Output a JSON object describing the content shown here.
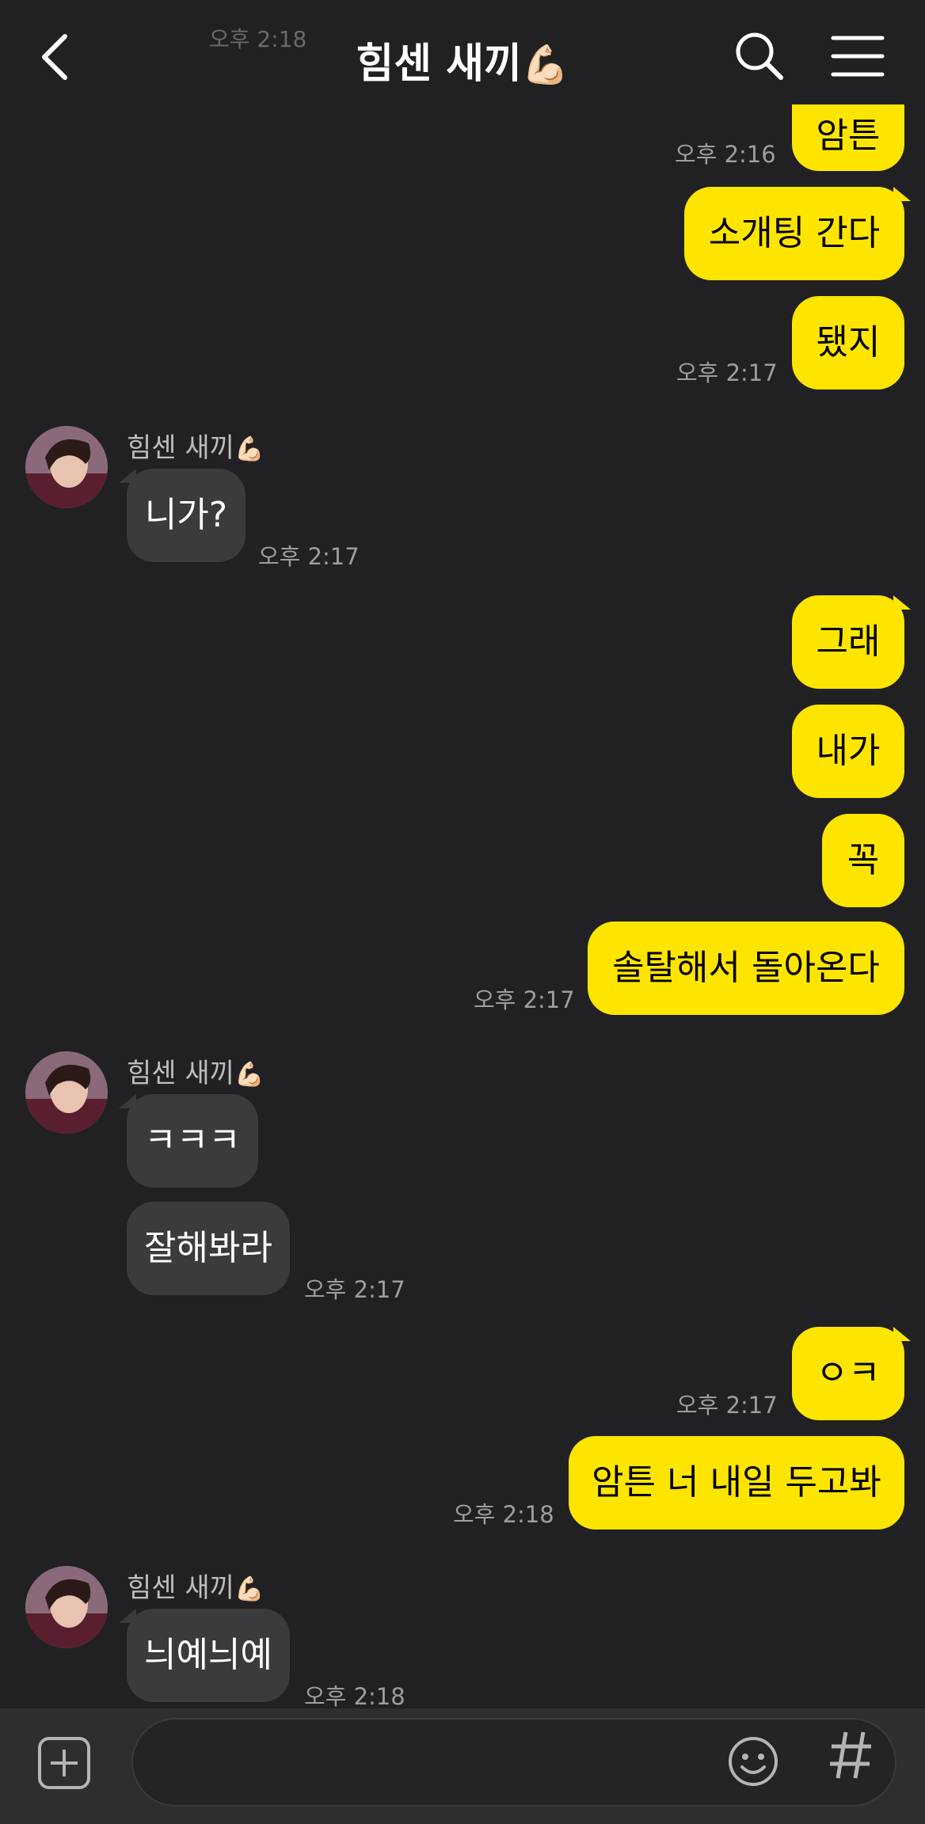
{
  "header": {
    "title": "힘센 새끼",
    "title_emoji": "💪🏻",
    "ghost_time": "오후 2:18"
  },
  "sender": {
    "name": "힘센 새끼",
    "emoji": "💪🏻"
  },
  "messages": [
    {
      "from": "me",
      "text": "암튼"
    },
    {
      "from": "me",
      "text": "소개팅 간다"
    },
    {
      "from": "me",
      "text": "됐지"
    },
    {
      "from": "them",
      "text": "니가?"
    },
    {
      "from": "me",
      "text": "그래"
    },
    {
      "from": "me",
      "text": "내가"
    },
    {
      "from": "me",
      "text": "꼭"
    },
    {
      "from": "me",
      "text": "솔탈해서 돌아온다"
    },
    {
      "from": "them",
      "text": "ㅋㅋㅋ"
    },
    {
      "from": "them",
      "text": "잘해봐라"
    },
    {
      "from": "me",
      "text": "ㅇㅋ"
    },
    {
      "from": "me",
      "text": "암튼 너 내일 두고봐"
    },
    {
      "from": "them",
      "text": "늬예늬예"
    }
  ],
  "times": {
    "t0": "오후 2:16",
    "t2": "오후 2:17",
    "t3": "오후 2:17",
    "t7": "오후 2:17",
    "t9": "오후 2:17",
    "t10": "오후 2:17",
    "t11": "오후 2:18",
    "t12": "오후 2:18"
  },
  "composer": {
    "value": "",
    "icons": [
      "plus-icon",
      "emoji-icon",
      "hashtag-icon"
    ]
  },
  "colors": {
    "background": "#212123",
    "my_bubble": "#fee500",
    "their_bubble": "#3b3b3d"
  }
}
